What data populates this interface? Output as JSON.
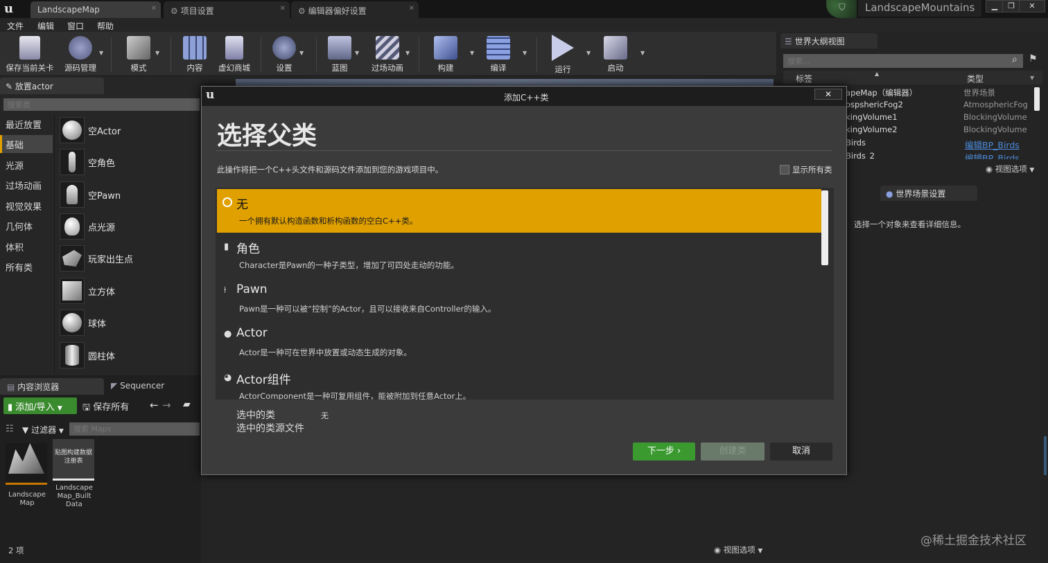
{
  "tabs": {
    "map": "LandscapeMap",
    "project_settings": "项目设置",
    "editor_prefs": "编辑器偏好设置",
    "project_name": "LandscapeMountains"
  },
  "menu": [
    "文件",
    "编辑",
    "窗口",
    "帮助"
  ],
  "toolbar": [
    {
      "label": "保存当前关卡",
      "icon": "save-icon"
    },
    {
      "label": "源码管理",
      "icon": "source-control-icon"
    },
    {
      "label": "模式",
      "icon": "modes-icon"
    },
    {
      "label": "内容",
      "icon": "content-icon"
    },
    {
      "label": "虚幻商城",
      "icon": "marketplace-icon"
    },
    {
      "label": "设置",
      "icon": "settings-icon"
    },
    {
      "label": "蓝图",
      "icon": "blueprint-icon"
    },
    {
      "label": "过场动画",
      "icon": "cinematics-icon"
    },
    {
      "label": "构建",
      "icon": "build-icon"
    },
    {
      "label": "编译",
      "icon": "compile-icon"
    },
    {
      "label": "运行",
      "icon": "play-icon"
    },
    {
      "label": "启动",
      "icon": "launch-icon"
    }
  ],
  "place_actor": {
    "tab": "放置actor",
    "search_placeholder": "搜索类",
    "categories": [
      "最近放置",
      "基础",
      "光源",
      "过场动画",
      "视觉效果",
      "几何体",
      "体积",
      "所有类"
    ],
    "items": [
      "空Actor",
      "空角色",
      "空Pawn",
      "点光源",
      "玩家出生点",
      "立方体",
      "球体",
      "圆柱体"
    ]
  },
  "content_browser": {
    "tab": "内容浏览器",
    "tab2": "Sequencer",
    "add_import": "添加/导入",
    "save_all": "保存所有",
    "filters": "过滤器",
    "search_placeholder": "搜索 Maps",
    "assets": [
      {
        "name": "Landscape Map",
        "thumb": ""
      },
      {
        "name": "Landscape Map_Built Data",
        "thumb": "贴图构建数据注册表"
      }
    ],
    "count": "2 项",
    "view_options": "视图选项"
  },
  "outliner": {
    "tab": "世界大纲视图",
    "search_placeholder": "搜索...",
    "col_label": "标签",
    "col_type": "类型",
    "rows": [
      {
        "label": "apeMap（编辑器）",
        "type": "世界场景"
      },
      {
        "label": "ospshericFog2",
        "type": "AtmosphericFog"
      },
      {
        "label": "kingVolume1",
        "type": "BlockingVolume"
      },
      {
        "label": "kingVolume2",
        "type": "BlockingVolume"
      },
      {
        "label": "Birds",
        "type": "编辑BP_Birds"
      },
      {
        "label": "Birds_2",
        "type": "编辑BP_Birds"
      }
    ],
    "view_options": "视图选项"
  },
  "details": {
    "tab": "世界场景设置",
    "message": "选择一个对象来查看详细信息。"
  },
  "dialog": {
    "title": "添加C++类",
    "heading": "选择父类",
    "description": "此操作将把一个C++头文件和源码文件添加到您的游戏项目中。",
    "show_all": "显示所有类",
    "options": [
      {
        "name": "无",
        "desc": "一个拥有默认构造函数和析构函数的空白C++类。",
        "icon": "radio-icon"
      },
      {
        "name": "角色",
        "desc": "Character是Pawn的一种子类型，增加了可四处走动的功能。",
        "icon": "character-icon"
      },
      {
        "name": "Pawn",
        "desc": "Pawn是一种可以被“控制”的Actor，且可以接收来自Controller的输入。",
        "icon": "pawn-icon"
      },
      {
        "name": "Actor",
        "desc": "Actor是一种可在世界中放置或动态生成的对象。",
        "icon": "actor-icon"
      },
      {
        "name": "Actor组件",
        "desc": "ActorComponent是一种可复用组件，能被附加到任意Actor上。",
        "icon": "component-icon"
      }
    ],
    "selected_class_label": "选中的类",
    "selected_class_value": "无",
    "selected_source_label": "选中的类源文件",
    "next": "下一步 ›",
    "create": "创建类",
    "cancel": "取消"
  },
  "watermark": "@稀土掘金技术社区"
}
